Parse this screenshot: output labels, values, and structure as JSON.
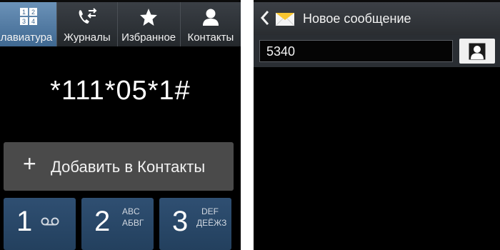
{
  "dialer": {
    "tabs": [
      {
        "label": "Клавиатура",
        "icon": "keypad-icon",
        "active": true
      },
      {
        "label": "Журналы",
        "icon": "call-log-icon",
        "active": false
      },
      {
        "label": "Избранное",
        "icon": "star-icon",
        "active": false
      },
      {
        "label": "Контакты",
        "icon": "contact-icon",
        "active": false
      }
    ],
    "number": "*111*05*1#",
    "add_button": {
      "plus": "+",
      "label": "Добавить в Контакты"
    },
    "keys": [
      {
        "digit": "1",
        "icon": "voicemail-icon"
      },
      {
        "digit": "2",
        "latin": "ABC",
        "cyrillic": "АБВГ"
      },
      {
        "digit": "3",
        "latin": "DEF",
        "cyrillic": "ДЕЁЖЗ"
      }
    ],
    "keypad_icon_digits": [
      "1",
      "2",
      "3",
      "4"
    ]
  },
  "message": {
    "title": "Новое сообщение",
    "back_icon": "back-chevron-icon",
    "app_icon": "envelope-icon",
    "recipient_value": "5340",
    "contact_button_icon": "contact-icon"
  },
  "colors": {
    "active_tab": "#4f7aa5",
    "keypad_key": "#2a4668",
    "add_button": "#4a4a4a",
    "header": "#33373c"
  }
}
